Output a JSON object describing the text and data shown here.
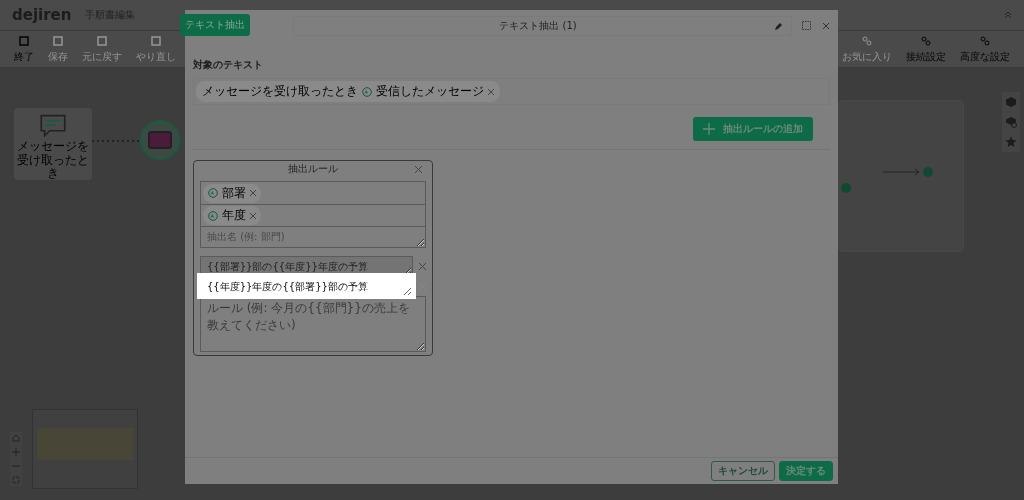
{
  "app": {
    "logo": "dejiren",
    "title": "手順書編集",
    "toolbar_left": [
      {
        "label": "終了",
        "disabled": false
      },
      {
        "label": "保存",
        "disabled": true
      },
      {
        "label": "元に戻す",
        "disabled": true
      },
      {
        "label": "やり直し",
        "disabled": true
      }
    ],
    "toolbar_right": [
      {
        "label": "お気に入り",
        "disabled": true
      },
      {
        "label": "接続設定",
        "disabled": false
      },
      {
        "label": "高度な設定",
        "disabled": false
      }
    ]
  },
  "canvas": {
    "trigger_node": {
      "label": "メッセージを受け取ったとき"
    }
  },
  "dialog": {
    "tab": "テキスト抽出",
    "title": "テキスト抽出 (1)",
    "target_label": "対象のテキスト",
    "target_chips": [
      {
        "source": "メッセージを受け取ったとき",
        "variable": "受信したメッセージ"
      }
    ],
    "add_button": "抽出ルールの追加",
    "rule": {
      "title": "抽出ルール",
      "variables": [
        "部署",
        "年度"
      ],
      "name_placeholder": "抽出名 (例: 部門)",
      "templates": [
        {
          "text": "{{部署}}部の{{年度}}年度の予算",
          "selected": false
        },
        {
          "text": "{{年度}}年度の{{部署}}部の予算",
          "selected": true
        }
      ],
      "template_placeholder": "ルール (例: 今月の{{部門}}の売上を教えてください)"
    },
    "cancel_button": "キャンセル",
    "ok_button": "決定する"
  }
}
